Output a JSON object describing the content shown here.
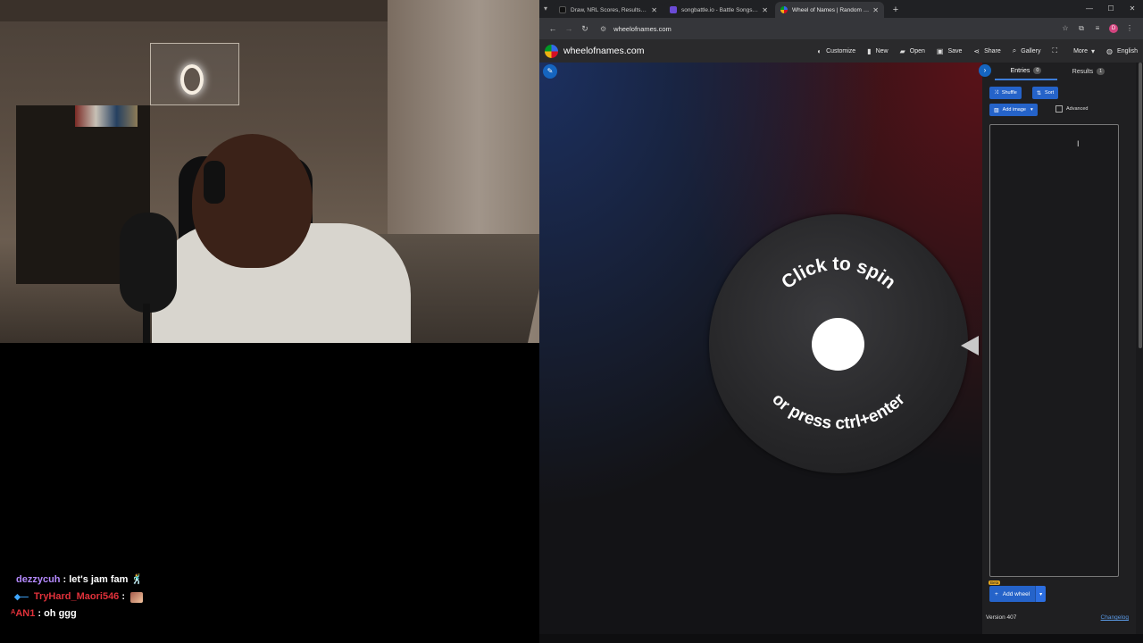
{
  "chat": [
    {
      "user": "dezzycuh",
      "message": ": let's jam fam 🕺"
    },
    {
      "user": "TryHard_Maori546",
      "message": ":"
    },
    {
      "user": "ᴬAN1",
      "message": ": oh ggg"
    }
  ],
  "browser": {
    "tabs": [
      {
        "label": "Draw, NRL Scores, Results, 2025",
        "color": "#222"
      },
      {
        "label": "songbattle.io - Battle Songs ag",
        "color": "#6b4bd6"
      },
      {
        "label": "Wheel of Names | Random name",
        "color": "#d50f25"
      }
    ],
    "url": "wheelofnames.com",
    "profile_initial": "D"
  },
  "app": {
    "site_name": "wheelofnames.com",
    "menu": [
      {
        "label": "Customize",
        "icon": "palette-icon"
      },
      {
        "label": "New",
        "icon": "file-icon"
      },
      {
        "label": "Open",
        "icon": "folder-icon"
      },
      {
        "label": "Save",
        "icon": "save-icon"
      },
      {
        "label": "Share",
        "icon": "share-icon"
      },
      {
        "label": "Gallery",
        "icon": "search-icon"
      },
      {
        "label": "More",
        "icon": "chevron-down-icon"
      },
      {
        "label": "English",
        "icon": "globe-icon"
      }
    ],
    "wheel": {
      "top_text": "Click to spin",
      "bottom_text": "or press ctrl+enter"
    },
    "panel": {
      "entries_label": "Entries",
      "entries_count": "0",
      "results_label": "Results",
      "results_count": "1",
      "shuffle_label": "Shuffle",
      "sort_label": "Sort",
      "add_image_label": "Add image",
      "advanced_label": "Advanced",
      "beta_label": "Beta",
      "add_wheel_label": "Add wheel",
      "version": "Version 407",
      "changelog": "Changelog"
    }
  }
}
